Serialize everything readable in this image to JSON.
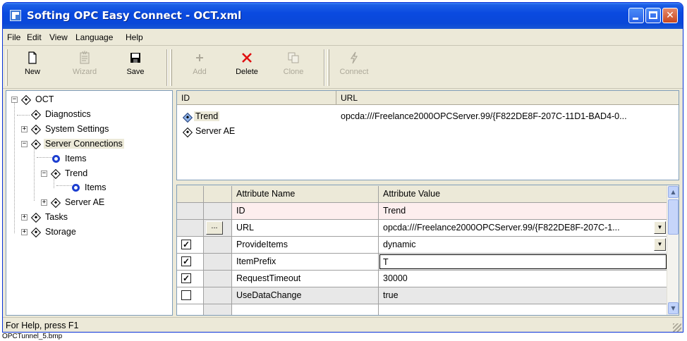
{
  "window": {
    "title": "Softing OPC Easy Connect - OCT.xml"
  },
  "menu": [
    "File",
    "Edit",
    "View",
    "Language",
    "Help"
  ],
  "toolbar": {
    "new": "New",
    "wizard": "Wizard",
    "save": "Save",
    "add": "Add",
    "delete": "Delete",
    "clone": "Clone",
    "connect": "Connect"
  },
  "tree": {
    "root": "OCT",
    "diagnostics": "Diagnostics",
    "server_settings": "System Settings",
    "server_connections": "Server Connections",
    "items1": "Items",
    "trend": "Trend",
    "items2": "Items",
    "server_ae": "Server AE",
    "tasks": "Tasks",
    "storage": "Storage"
  },
  "list": {
    "headers": [
      "ID",
      "URL"
    ],
    "rows": [
      {
        "id": "Trend",
        "url": "opcda:///Freelance2000OPCServer.99/{F822DE8F-207C-11D1-BAD4-0..."
      },
      {
        "id": "Server AE",
        "url": ""
      }
    ]
  },
  "grid": {
    "headers": [
      "Attribute Name",
      "Attribute Value"
    ],
    "rows": [
      {
        "name": "ID",
        "value": "Trend",
        "checked": null
      },
      {
        "name": "URL",
        "value": "opcda:///Freelance2000OPCServer.99/{F822DE8F-207C-1...",
        "checked": null,
        "ellipsis": "..."
      },
      {
        "name": "ProvideItems",
        "value": "dynamic",
        "checked": true
      },
      {
        "name": "ItemPrefix",
        "value": "T",
        "checked": true
      },
      {
        "name": "RequestTimeout",
        "value": "30000",
        "checked": true
      },
      {
        "name": "UseDataChange",
        "value": "true",
        "checked": false
      }
    ]
  },
  "status": {
    "text": "For Help, press F1"
  },
  "caption": "OPCTunnel_5.bmp",
  "colors": {
    "title_bar": "#0a4ae0",
    "selected_row_bg": "#fdeeee",
    "tree_dot": "#1d3fd0"
  }
}
